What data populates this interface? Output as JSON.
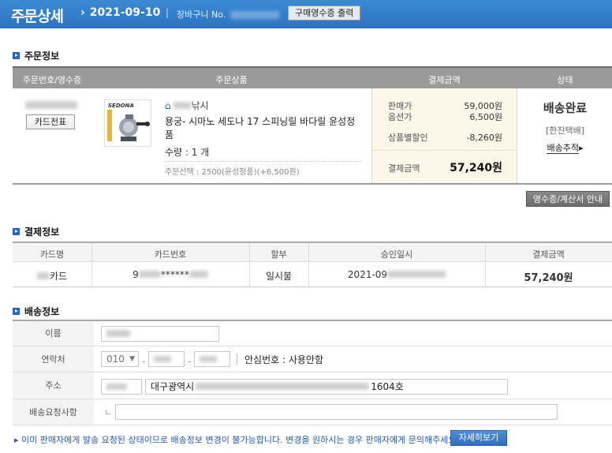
{
  "header": {
    "title": "주문상세",
    "order_date": "2021-09-10",
    "cart_no_label": "장바구니 No.",
    "receipt_button": "구매영수증 출력"
  },
  "order_info": {
    "section_title": "주문정보",
    "columns": [
      "주문번호/영수증",
      "주문상품",
      "결제금액",
      "상태"
    ],
    "card_slip_button": "카드전표",
    "product": {
      "image_brand": "SEDONA",
      "shop_suffix": "낚시",
      "name": "용궁- 시마노 세도나 17 스피닝릴 바다릴 윤성정품",
      "quantity": "수량 : 1 개",
      "option": "주문선택 : 2500(윤성정품)(+6,500원)"
    },
    "payment": {
      "sale_price_label": "판매가",
      "sale_price": "59,000원",
      "option_price_label": "옵션가",
      "option_price": "6,500원",
      "discount_label": "상품별할인",
      "discount": "-8,260원",
      "total_label": "결제금액",
      "total": "57,240원"
    },
    "status": {
      "state": "배송완료",
      "courier": "[한진택배]",
      "track_link": "배송추적"
    },
    "vat_button": "영수증/계산서 안내"
  },
  "payment_info": {
    "section_title": "결제정보",
    "columns": [
      "카드명",
      "카드번호",
      "할부",
      "승인일시",
      "결제금액"
    ],
    "row": {
      "card_name_suffix": "카드",
      "card_no_prefix": "9",
      "card_no_mask": "******",
      "installment": "일시불",
      "approved_prefix": "2021-09",
      "amount": "57,240원"
    }
  },
  "delivery_info": {
    "section_title": "배송정보",
    "name_label": "이름",
    "phone_label": "연락처",
    "phone_prefix": "010",
    "safe_number": "안심번호 : 사용안함",
    "address_label": "주소",
    "address_city": "대구광역시",
    "address_tail": "1604호",
    "request_label": "배송요청사항",
    "request_marker": "ㄴ"
  },
  "notice": {
    "text": "이미 판매자에게 발송 요청된 상태이므로 배송정보 변경이 불가능합니다. 변경을 원하시는 경우 판매자에게 문의해주세요.",
    "detail_button": "자세히보기"
  }
}
